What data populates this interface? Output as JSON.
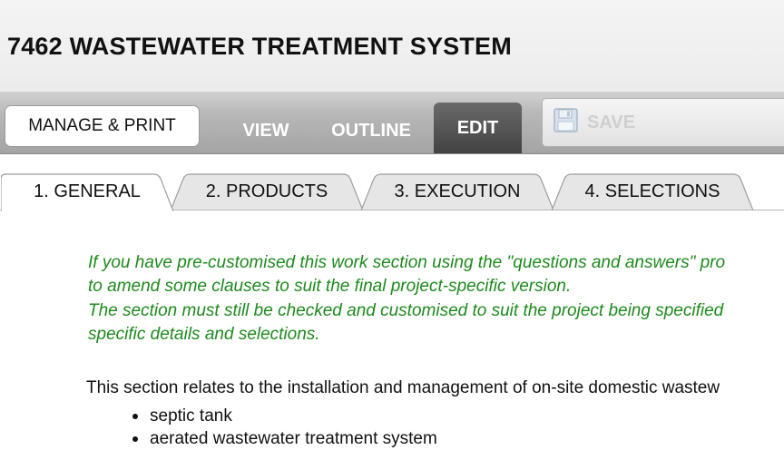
{
  "header": {
    "title": "7462 WASTEWATER TREATMENT SYSTEM"
  },
  "toolbar": {
    "manage_label": "MANAGE & PRINT",
    "modes": [
      "VIEW",
      "OUTLINE",
      "EDIT"
    ],
    "active_mode": "EDIT",
    "save_label": "SAVE",
    "save_icon": "floppy-disk-icon"
  },
  "section_tabs": [
    {
      "label": "1. GENERAL",
      "active": true
    },
    {
      "label": "2. PRODUCTS",
      "active": false
    },
    {
      "label": "3. EXECUTION",
      "active": false
    },
    {
      "label": "4. SELECTIONS",
      "active": false
    }
  ],
  "content": {
    "note_lines": [
      "If you have pre-customised this work section using the \"questions and answers\" pro",
      "to amend some clauses to suit the final project-specific version.",
      "The section must still be checked and customised to suit the project being specified",
      "specific details and selections."
    ],
    "intro": "This section relates to the installation and management of on-site domestic wastew",
    "items": [
      "septic tank",
      "aerated wastewater treatment system"
    ]
  },
  "colors": {
    "note_text": "#1d8a1d",
    "active_mode_bg": "#4e4e4e",
    "toolbar_bg": "#b0b0b0"
  }
}
